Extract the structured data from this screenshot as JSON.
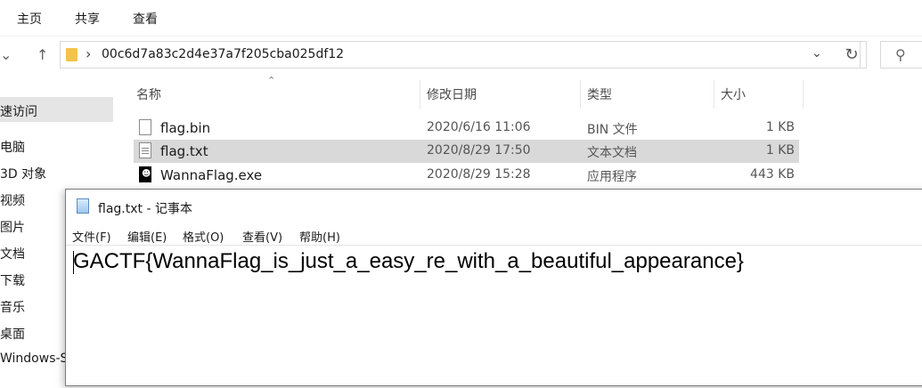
{
  "ribbon": {
    "tabs": [
      "主页",
      "共享",
      "查看"
    ]
  },
  "address": {
    "path": "00c6d7a83c2d4e37a7f205cba025df12"
  },
  "nav": {
    "items": [
      "快速访问",
      "此电脑",
      "3D 对象",
      "视频",
      "图片",
      "文档",
      "下载",
      "音乐",
      "桌面",
      "Windows-SSD"
    ],
    "visible_labels": [
      "速访问",
      "电脑",
      "3D 对象",
      "视频",
      "图片",
      "文档",
      "下载",
      "音乐",
      "桌面",
      "Windows-S"
    ]
  },
  "columns": {
    "name": "名称",
    "date": "修改日期",
    "type": "类型",
    "size": "大小"
  },
  "files": [
    {
      "name": "flag.bin",
      "date": "2020/6/16 11:06",
      "type": "BIN 文件",
      "size": "1 KB",
      "icon": "blank-file-icon",
      "selected": false
    },
    {
      "name": "flag.txt",
      "date": "2020/8/29 17:50",
      "type": "文本文档",
      "size": "1 KB",
      "icon": "text-file-icon",
      "selected": true
    },
    {
      "name": "WannaFlag.exe",
      "date": "2020/8/29 15:28",
      "type": "应用程序",
      "size": "443 KB",
      "icon": "exe-app-icon",
      "selected": false
    }
  ],
  "notepad": {
    "title": "flag.txt - 记事本",
    "menu": [
      "文件(F)",
      "编辑(E)",
      "格式(O)",
      "查看(V)",
      "帮助(H)"
    ],
    "content": "GACTF{WannaFlag_is_just_a_easy_re_with_a_beautiful_appearance}"
  },
  "colors": {
    "selected_row": "#d9d9d9",
    "nav_selected": "#e5e5e5",
    "folder": "#f3c34a"
  }
}
